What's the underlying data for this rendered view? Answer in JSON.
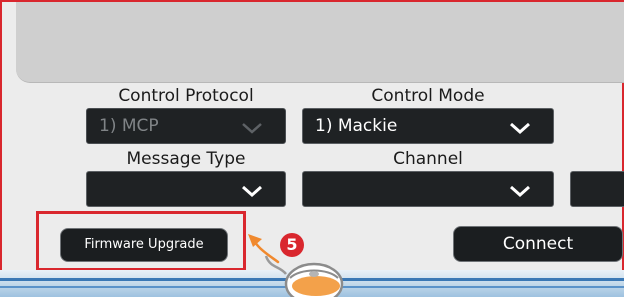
{
  "protocol": {
    "label": "Control Protocol",
    "value": "1) MCP"
  },
  "mode": {
    "label": "Control Mode",
    "value": "1) Mackie"
  },
  "message_type": {
    "label": "Message Type",
    "value": ""
  },
  "channel": {
    "label": "Channel",
    "value": ""
  },
  "buttons": {
    "firmware_upgrade": "Firmware Upgrade",
    "connect": "Connect"
  },
  "callout": {
    "step_number": "5"
  },
  "colors": {
    "highlight": "#d9272e",
    "control_bg": "#1f2224",
    "panel_bg": "#ececec"
  },
  "icons": [
    "chevron-down-icon",
    "arrow-icon",
    "mouse-icon"
  ]
}
